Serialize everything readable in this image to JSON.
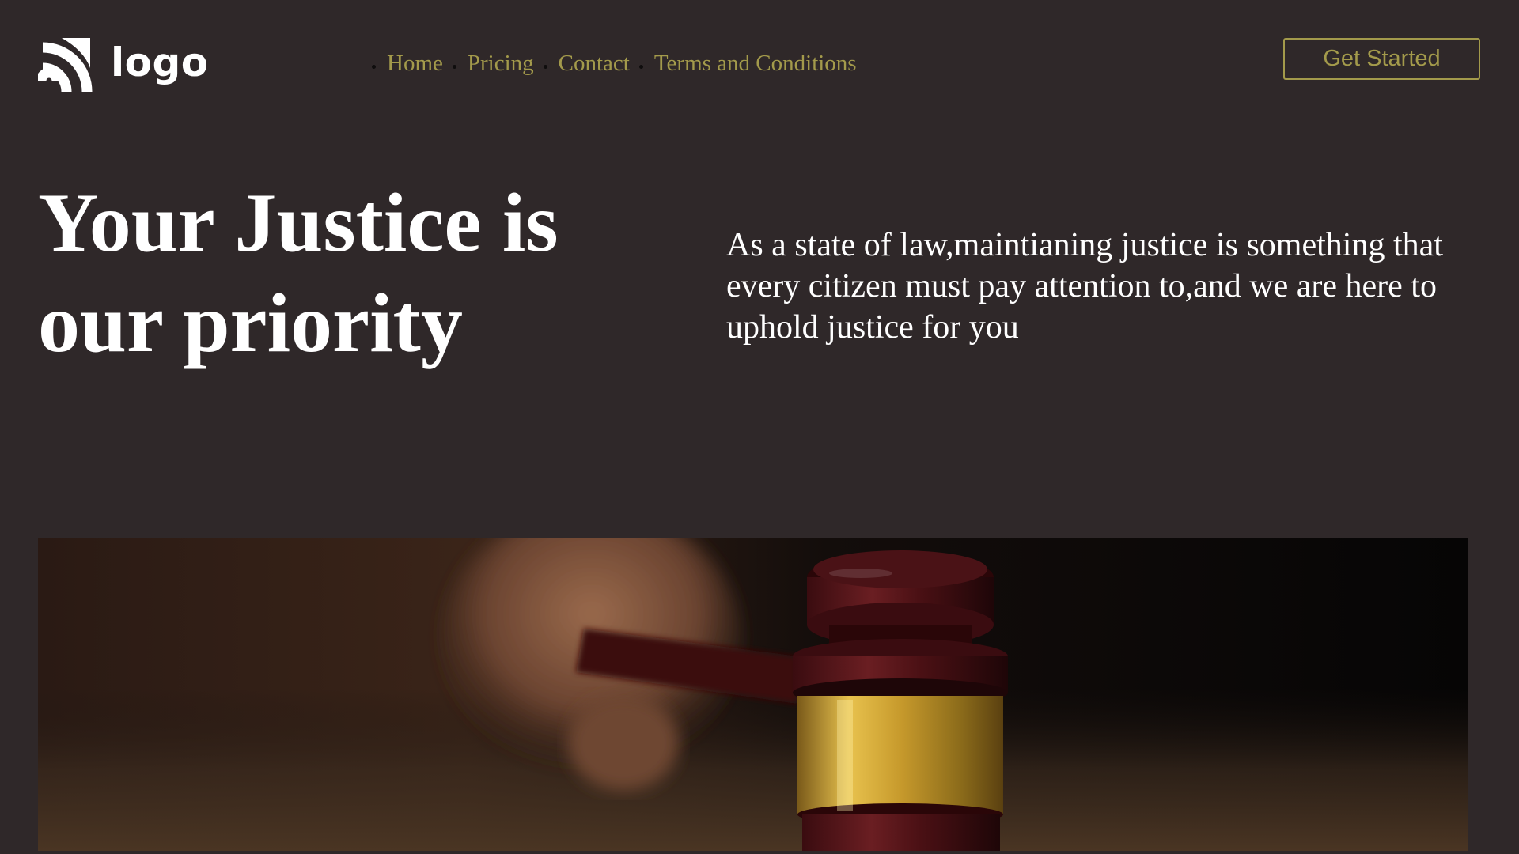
{
  "header": {
    "logo_text": "logo",
    "nav": [
      {
        "label": "Home"
      },
      {
        "label": "Pricing"
      },
      {
        "label": "Contact"
      },
      {
        "label": "Terms and Conditions"
      }
    ],
    "cta_label": "Get Started"
  },
  "hero": {
    "title_line1": "Your Justice is",
    "title_line2": "our priority",
    "description": "As a state of law,maintianing justice is something that every citizen must pay attention to,and we are here to uphold justice for you"
  },
  "icons": {
    "logo": "rss-arcs-icon"
  },
  "colors": {
    "background": "#2f2829",
    "accent": "#a39a4b",
    "text": "#ffffff"
  }
}
